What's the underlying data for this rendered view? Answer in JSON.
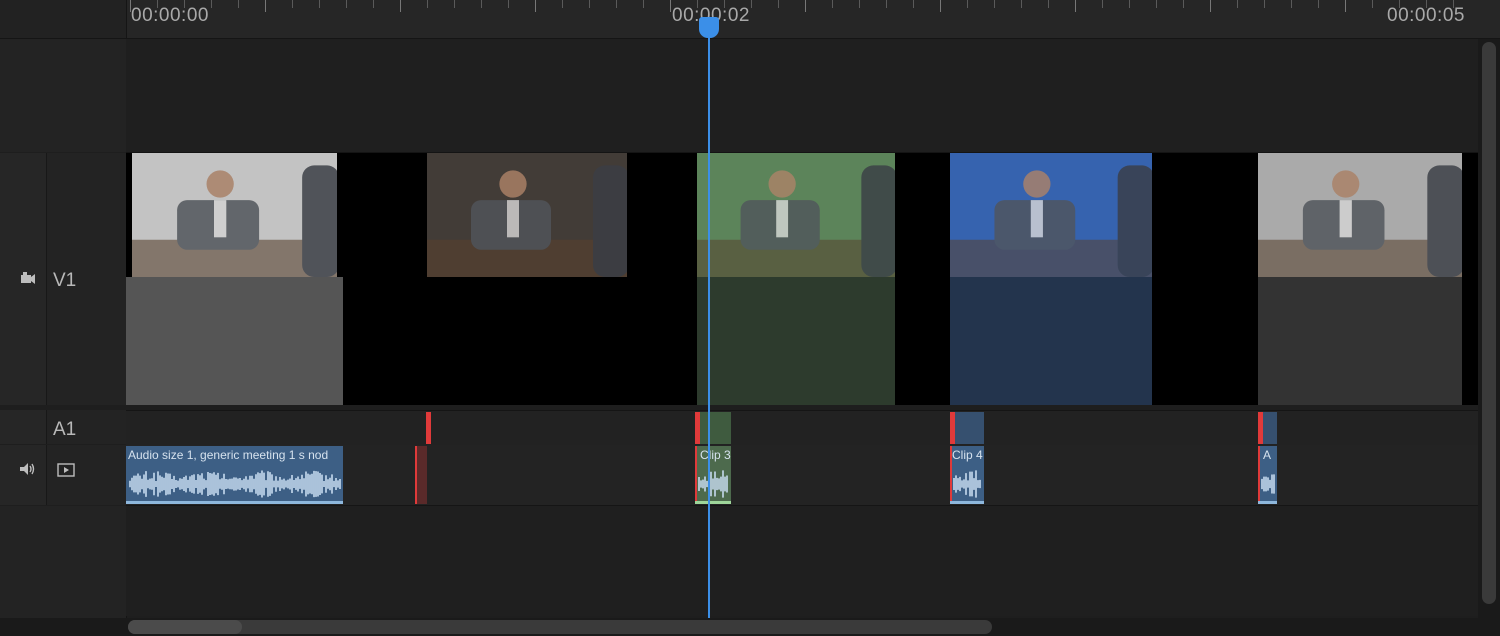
{
  "ruler": {
    "timecodes": [
      "00:00:00",
      "00:00:02",
      "00:00:05"
    ]
  },
  "tracks": {
    "video": {
      "label": "V1",
      "icon": "camera-icon"
    },
    "audio": {
      "label": "A1",
      "icons": [
        "speaker-icon",
        "play-icon"
      ]
    }
  },
  "video_clips": [
    {
      "name": "clip-1",
      "tint": "#8a8a8a",
      "thumb_bg": "#ffffff",
      "fill": "#555555"
    },
    {
      "name": "clip-2",
      "tint": "#3b3530",
      "thumb_bg": "#4a4540",
      "fill": "#000000"
    },
    {
      "name": "clip-3",
      "tint": "#4b6a4a",
      "thumb_bg": "#6fa06a",
      "fill": "#2e3b2e"
    },
    {
      "name": "clip-4",
      "tint": "#2e4f8a",
      "thumb_bg": "#3f79d6",
      "fill": "#23344d"
    },
    {
      "name": "clip-5",
      "tint": "#7f7f7f",
      "thumb_bg": "#d8d8d8",
      "fill": "#333333"
    }
  ],
  "audio_clips": [
    {
      "label": "Audio size  1, generic meeting  1 s  nod"
    },
    {
      "label": ""
    },
    {
      "label": "Clip 3"
    },
    {
      "label": "Clip 4"
    },
    {
      "label": "A"
    }
  ],
  "playhead": {
    "time": "00:00:02",
    "color": "#3b8fe8"
  },
  "colors": {
    "marker": "#e03a3a",
    "audio_clip": "#3d5f85"
  }
}
